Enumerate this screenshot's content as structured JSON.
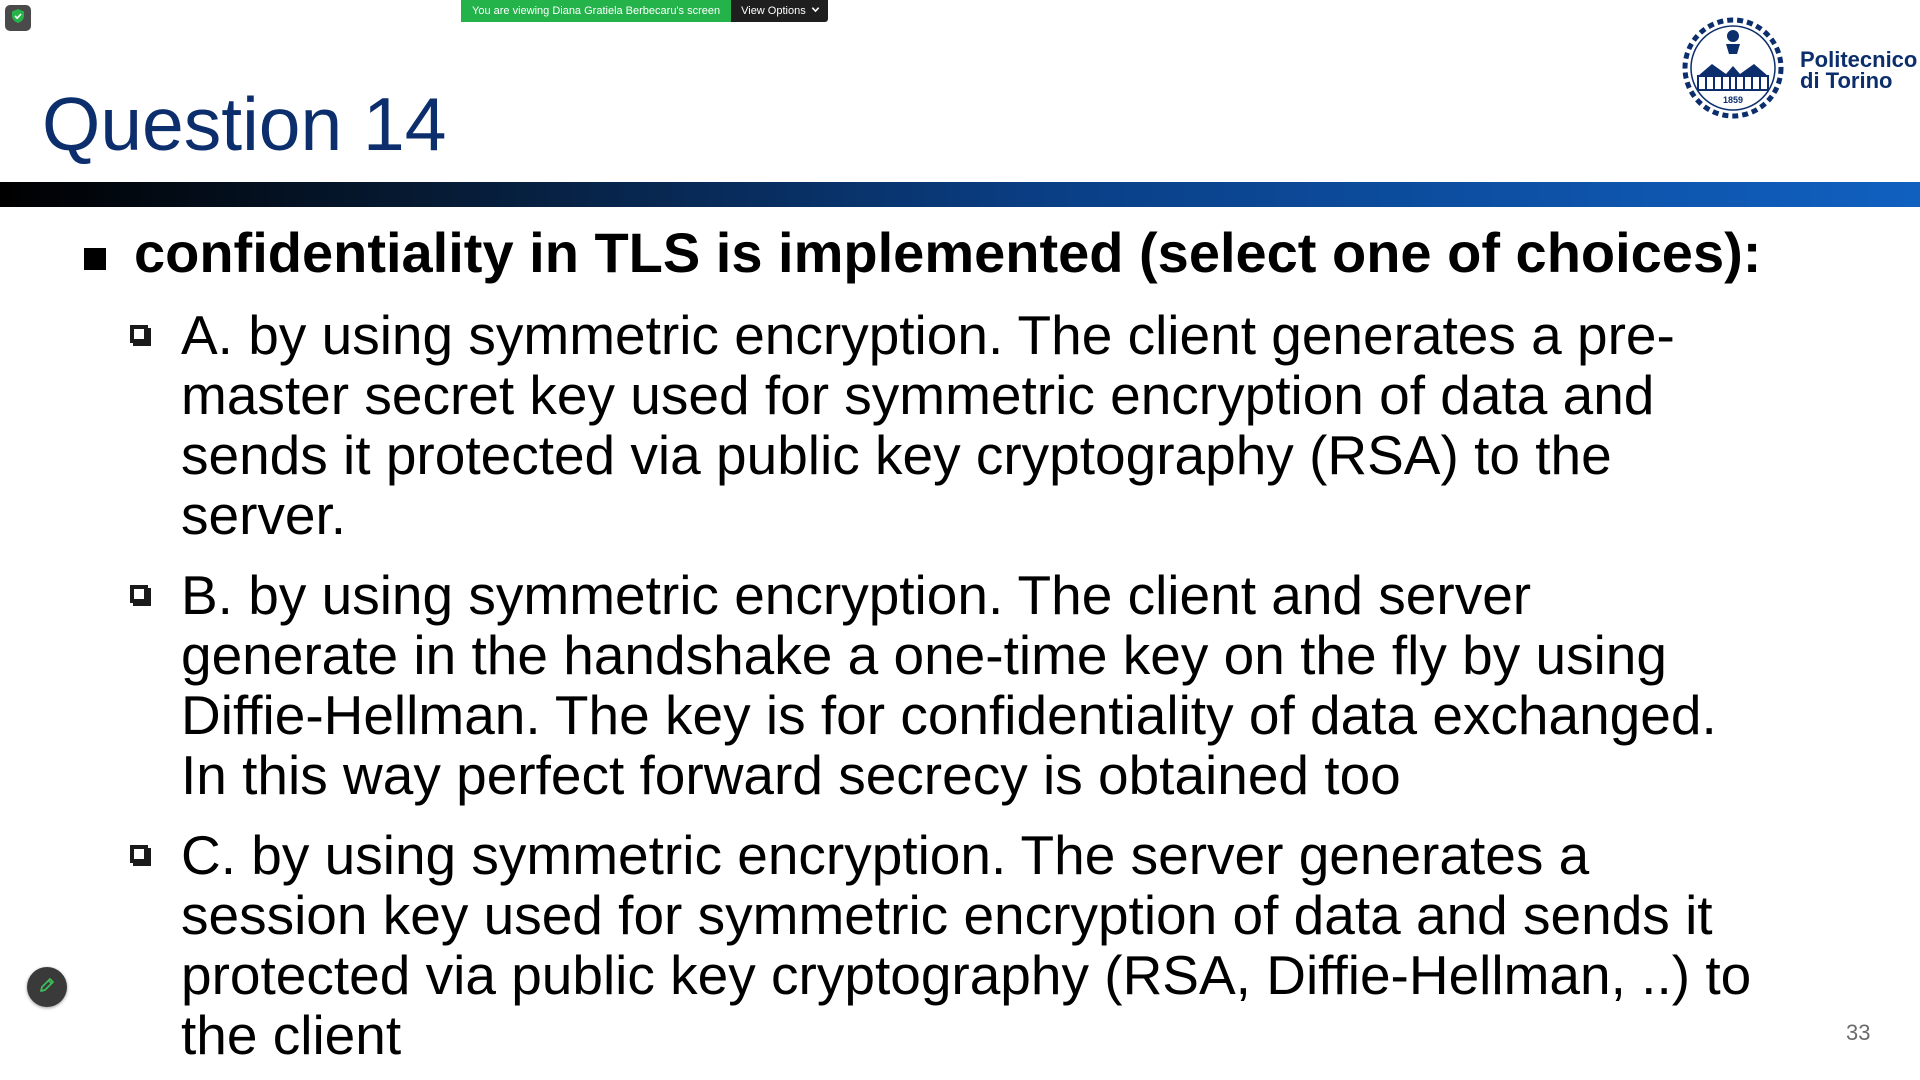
{
  "share_banner": {
    "text": "You are viewing Diana Gratiela Berbecaru's screen",
    "view_options_label": "View Options",
    "banner_color": "#24b24b"
  },
  "icons": {
    "shield": "shield-icon",
    "chevron": "chevron-down-icon",
    "pen": "pen-icon",
    "logo": "university-seal-icon"
  },
  "slide": {
    "title": "Question 14",
    "title_color": "#0c2e6c",
    "logo": {
      "line1": "Politecnico",
      "line2": "di Torino",
      "year": "1859"
    },
    "question": "confidentiality in TLS is implemented (select one of choices):",
    "options": [
      {
        "lines": [
          "A. by using symmetric encryption. The client generates a pre-",
          "master secret key used for symmetric encryption of data and",
          "sends it protected via public key cryptography (RSA) to the",
          "server."
        ]
      },
      {
        "lines": [
          "B. by using symmetric encryption. The client and server",
          "generate in the handshake a one-time key on the fly by using",
          "Diffie-Hellman. The key is for confidentiality of data exchanged.",
          "In this way perfect forward secrecy is obtained too"
        ]
      },
      {
        "lines": [
          "C. by using symmetric encryption. The server generates a",
          "session key used for symmetric encryption of data and sends it",
          "protected via public key cryptography (RSA, Diffie-Hellman, ..) to",
          "the client"
        ]
      }
    ],
    "page_number": "33"
  }
}
